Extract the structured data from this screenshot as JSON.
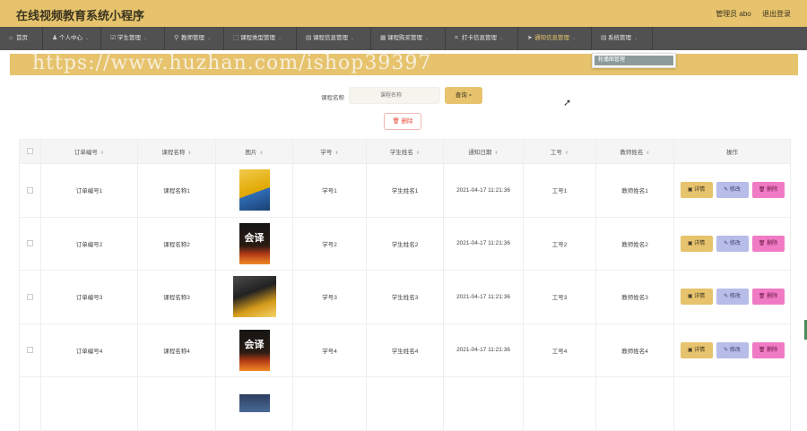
{
  "app": {
    "title": "在线视频教育系统小程序",
    "user_label": "管理员 abo",
    "logout_label": "退出登录"
  },
  "nav": {
    "items": [
      {
        "label": "首页",
        "icon": "home-icon",
        "glyph": "⌂",
        "caret": ""
      },
      {
        "label": "个人中心",
        "icon": "user-icon",
        "glyph": "♟",
        "caret": "⌄"
      },
      {
        "label": "学生管理",
        "icon": "check-icon",
        "glyph": "☑",
        "caret": "⌄"
      },
      {
        "label": "教师管理",
        "icon": "pin-icon",
        "glyph": "⚲",
        "caret": "⌄"
      },
      {
        "label": "课程类型管理",
        "icon": "frame-icon",
        "glyph": "⬚",
        "caret": "⌄"
      },
      {
        "label": "课程信息管理",
        "icon": "doc-icon",
        "glyph": "▤",
        "caret": "⌄"
      },
      {
        "label": "课程购买管理",
        "icon": "grid-icon",
        "glyph": "▦",
        "caret": "⌄"
      },
      {
        "label": "打卡信息管理",
        "icon": "clock-icon",
        "glyph": "⌗",
        "caret": "⌄"
      },
      {
        "label": "通知信息管理",
        "icon": "send-icon",
        "glyph": "➤",
        "caret": "⌄"
      },
      {
        "label": "系统管理",
        "icon": "settings-icon",
        "glyph": "▤",
        "caret": "⌄"
      }
    ],
    "dropdown_item": "轮播图管理"
  },
  "watermark": "https://www.huzhan.com/ishop39397",
  "search": {
    "label": "课程名称",
    "placeholder": "课程名称",
    "query_label": "查询 ⌕"
  },
  "delete_label": "🗑 删除",
  "table": {
    "headers": [
      "订单编号",
      "课程名称",
      "图片",
      "学号",
      "学生姓名",
      "通知日期",
      "工号",
      "教师姓名",
      "操作"
    ],
    "rows": [
      {
        "order": "订单编号1",
        "course": "课程名称1",
        "sid": "学号1",
        "sname": "学生姓名1",
        "date": "2021-04-17 11:21:36",
        "tid": "工号1",
        "tname": "教师姓名1",
        "thumb": "t1",
        "glyph": ""
      },
      {
        "order": "订单编号2",
        "course": "课程名称2",
        "sid": "学号2",
        "sname": "学生姓名2",
        "date": "2021-04-17 11:21:36",
        "tid": "工号2",
        "tname": "教师姓名2",
        "thumb": "t2",
        "glyph": "会译"
      },
      {
        "order": "订单编号3",
        "course": "课程名称3",
        "sid": "学号3",
        "sname": "学生姓名3",
        "date": "2021-04-17 11:21:36",
        "tid": "工号3",
        "tname": "教师姓名3",
        "thumb": "t3",
        "glyph": ""
      },
      {
        "order": "订单编号4",
        "course": "课程名称4",
        "sid": "学号4",
        "sname": "学生姓名4",
        "date": "2021-04-17 11:21:36",
        "tid": "工号4",
        "tname": "教师姓名4",
        "thumb": "t2",
        "glyph": "会译"
      }
    ],
    "actions": {
      "detail": "▣ 详情",
      "edit": "✎ 修改",
      "delete": "🗑 删除"
    }
  },
  "colors": {
    "accent": "#e6c36c",
    "nav_bg": "#515151",
    "edit": "#b7bde8",
    "delete": "#f07bc4"
  }
}
